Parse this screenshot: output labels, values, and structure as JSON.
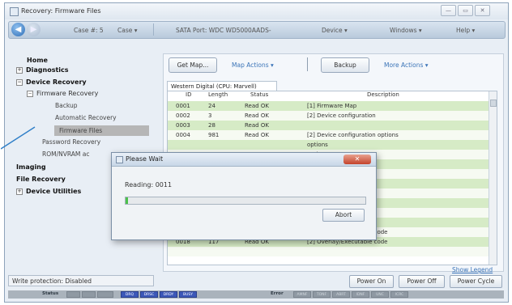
{
  "window": {
    "title": "Recovery: Firmware Files",
    "controls": {
      "minimize": "—",
      "maximize": "▭",
      "close": "✕"
    }
  },
  "navbar": {
    "case_label": "Case #: 5",
    "case_menu": "Case ▾",
    "port": "SATA Port: WDC WD5000AADS-",
    "device_menu": "Device ▾",
    "windows_menu": "Windows ▾",
    "help_menu": "Help ▾"
  },
  "sidebar": {
    "home": "Home",
    "diagnostics": "Diagnostics",
    "device_recovery": "Device Recovery",
    "firmware_recovery": "Firmware Recovery",
    "backup": "Backup",
    "automatic_recovery": "Automatic Recovery",
    "firmware_files": "Firmware Files",
    "password_recovery": "Password Recovery",
    "rom_nvram": "ROM/NVRAM ac",
    "imaging": "Imaging",
    "file_recovery": "File Recovery",
    "device_utilities": "Device Utilities",
    "expand_plus": "+",
    "expand_minus": "−"
  },
  "toolbar": {
    "get_map": "Get Map...",
    "map_actions": "Map Actions ▾",
    "backup": "Backup",
    "more_actions": "More Actions ▾"
  },
  "tab": {
    "label": "Western Digital (CPU: Marvell)"
  },
  "table": {
    "columns": [
      "ID",
      "Length",
      "Status",
      "Description"
    ],
    "rows": [
      {
        "id": "0001",
        "length": "24",
        "status": "Read OK",
        "desc": "[1] Firmware Map"
      },
      {
        "id": "0002",
        "length": "3",
        "status": "Read OK",
        "desc": "[2] Device configuration"
      },
      {
        "id": "0003",
        "length": "28",
        "status": "Read OK",
        "desc": ""
      },
      {
        "id": "0004",
        "length": "981",
        "status": "Read OK",
        "desc": "[2] Device configuration options"
      },
      {
        "id": "",
        "length": "",
        "status": "",
        "desc": "options"
      },
      {
        "id": "",
        "length": "",
        "status": "",
        "desc": "options"
      },
      {
        "id": "",
        "length": "",
        "status": "",
        "desc": "ode"
      },
      {
        "id": "",
        "length": "",
        "status": "",
        "desc": "ode"
      },
      {
        "id": "",
        "length": "",
        "status": "",
        "desc": "ode"
      },
      {
        "id": "",
        "length": "",
        "status": "",
        "desc": "ode"
      },
      {
        "id": "",
        "length": "",
        "status": "",
        "desc": "ode"
      },
      {
        "id": "",
        "length": "",
        "status": "",
        "desc": "ode"
      },
      {
        "id": "",
        "length": "",
        "status": "",
        "desc": "ode"
      },
      {
        "id": "",
        "length": "",
        "status": "",
        "desc": "[1] Overlay/Executable code"
      },
      {
        "id": "0018",
        "length": "117",
        "status": "Read OK",
        "desc": "[2] Overlay/Executable code"
      },
      {
        "id": "",
        "length": "",
        "status": "",
        "desc": ""
      }
    ]
  },
  "dialog": {
    "title": "Please Wait",
    "reading": "Reading: 0011",
    "progress_fraction": 0.01,
    "abort": "Abort",
    "close": "✕"
  },
  "show_legend": "Show Legend",
  "bottom": {
    "write_protection": "Write protection: Disabled",
    "power_on": "Power On",
    "power_off": "Power Off",
    "power_cycle": "Power Cycle"
  },
  "statusbar": {
    "status_label": "Status",
    "error_label": "Error",
    "status_regs": [
      {
        "label": "DRQ",
        "on": true
      },
      {
        "label": "DRSC",
        "on": true
      },
      {
        "label": "DRDY",
        "on": true
      },
      {
        "label": "BUSY",
        "on": true
      }
    ],
    "error_regs": [
      {
        "label": "AMNF",
        "on": false
      },
      {
        "label": "TONF",
        "on": false
      },
      {
        "label": "ABRT",
        "on": false
      },
      {
        "label": "IDNF",
        "on": false
      },
      {
        "label": "UNC",
        "on": false
      },
      {
        "label": "ICRC",
        "on": false
      }
    ]
  },
  "colors": {
    "accent_link": "#3b74b8",
    "row_green": "#d6ebc6",
    "progress": "#4cc04c",
    "selected": "#b6b6b6"
  }
}
